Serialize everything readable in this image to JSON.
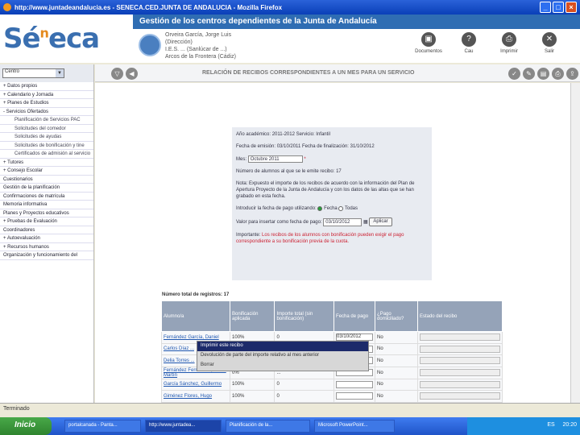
{
  "window": {
    "title": "http://www.juntadeandalucia.es - SENECA.CED.JUNTA DE ANDALUCIA - Mozilla Firefox"
  },
  "header": {
    "banner": "Gestión de los centros dependientes de la Junta de Andalucía",
    "logo_main": "Sé",
    "logo_sup": "n",
    "logo_tail": "eca",
    "user_lines": [
      "Orveira García, Jorge Luis",
      "(Dirección)",
      "I.E.S. ... (Sanlúcar de ...)",
      "Arcos de la Frontera (Cádiz)"
    ],
    "actions": [
      {
        "label": "Documentos",
        "icon": "documents-icon",
        "glyph": "▣"
      },
      {
        "label": "Cau",
        "icon": "help-icon",
        "glyph": "?"
      },
      {
        "label": "Imprimir",
        "icon": "print-icon",
        "glyph": "⎙"
      },
      {
        "label": "Salir",
        "icon": "exit-icon",
        "glyph": "✕"
      }
    ]
  },
  "sidebar": {
    "selected": "Centro",
    "items": [
      {
        "label": "+ Datos propios",
        "type": "main"
      },
      {
        "label": "+ Calendario y Jornada",
        "type": "main"
      },
      {
        "label": "+ Planes de Estudios",
        "type": "main"
      },
      {
        "label": "- Servicios Ofertados",
        "type": "main"
      },
      {
        "label": "Planificación de Servicios PAC",
        "type": "sub"
      },
      {
        "label": "Solicitudes del comedor",
        "type": "sub"
      },
      {
        "label": "Solicitudes de ayudas",
        "type": "sub"
      },
      {
        "label": "Solicitudes de bonificación y tine",
        "type": "sub"
      },
      {
        "label": "Certificados de admisión al servicio",
        "type": "sub"
      },
      {
        "label": "+ Tutores",
        "type": "main"
      },
      {
        "label": "+ Consejo Escolar",
        "type": "main"
      },
      {
        "label": "Cuestionarios",
        "type": "main"
      },
      {
        "label": "Gestión de la planificación",
        "type": "main"
      },
      {
        "label": "Confirmaciones de matrícula",
        "type": "main"
      },
      {
        "label": "Memoria informativa",
        "type": "main"
      },
      {
        "label": "Planes y Proyectos educativos",
        "type": "main"
      },
      {
        "label": "+ Pruebas de Evaluación",
        "type": "main"
      },
      {
        "label": "Coordinadores",
        "type": "main"
      },
      {
        "label": "+ Autoevaluación",
        "type": "main"
      },
      {
        "label": "+ Recursos humanos",
        "type": "main"
      },
      {
        "label": "Organización y funcionamiento del",
        "type": "main"
      }
    ]
  },
  "toolbar": {
    "title": "RELACIÓN DE RECIBOS CORRESPONDIENTES A UN MES PARA UN SERVICIO",
    "left_icons": [
      "filter-icon",
      "back-icon"
    ],
    "right_icons": [
      "accept-icon",
      "edit-icon",
      "report-icon",
      "print-icon",
      "export-icon"
    ]
  },
  "form": {
    "line1": "Año académico: 2011-2012  Servicio: Infantil",
    "line2": "Fecha de emisión: 03/10/2011  Fecha de finalización: 31/10/2012",
    "month_label": "Mes:",
    "month_value": "Octubre 2011",
    "asterisk": "*",
    "line4": "Número de alumnos al que se le emite recibo: 17",
    "note": "Nota: Expuesto el importe de los recibos de acuerdo con la información del Plan de Apertura Proyecto de la Junta de Andalucía y con los datos de las altas que se han grabado en esta fecha.",
    "date_pay_label": "Introducir la fecha de pago utilizando:",
    "radio_label_1": "Fecha",
    "radio_label_2": "Todas",
    "value_label": "Valor para insertar como fecha de pago:",
    "value_input": "03/10/2012",
    "apply_button": "Aplicar",
    "important_label": "Importante:",
    "important_text": "Los recibos de los alumnos con bonificación pueden exigir el pago correspondiente a su bonificación previa de la cuota."
  },
  "table": {
    "count_label": "Número total de registros: 17",
    "headers": [
      "Alumno/a",
      "Bonificación aplicada",
      "Importe total (sin bonificación)",
      "Fecha de pago",
      "¿Pago domiciliado?",
      "Estado del recibo"
    ],
    "rows": [
      {
        "name": "Fernández García, Daniel",
        "bonus": "100%",
        "amount": "0",
        "date": "03/10/2012",
        "paid": "No"
      },
      {
        "name": "Carlos Díaz ...",
        "bonus": "",
        "amount": "",
        "date": "",
        "paid": "No"
      },
      {
        "name": "Delia Torres ...",
        "bonus": "",
        "amount": "",
        "date": "",
        "paid": "No"
      },
      {
        "name": "Fernández Fernández, Pablo Martín",
        "bonus": "0%",
        "amount": "...",
        "date": "",
        "paid": "No"
      },
      {
        "name": "García Sánchez, Guillermo",
        "bonus": "100%",
        "amount": "0",
        "date": "",
        "paid": "No"
      },
      {
        "name": "Giménez Flores, Hugo",
        "bonus": "100%",
        "amount": "0",
        "date": "",
        "paid": "No"
      }
    ]
  },
  "context_menu": {
    "items": [
      "Imprimir este recibo",
      "Devolución de parte del importe relativo al mes anterior",
      "Borrar"
    ]
  },
  "statusbar": {
    "text": "Terminado"
  },
  "taskbar": {
    "start": "Inicio",
    "tasks": [
      "portalcanada - Panta...",
      "http://www.juntadea...",
      "Planificación de la...",
      "Microsoft PowerPoint..."
    ],
    "tray_lang": "ES",
    "clock": "20:20"
  }
}
